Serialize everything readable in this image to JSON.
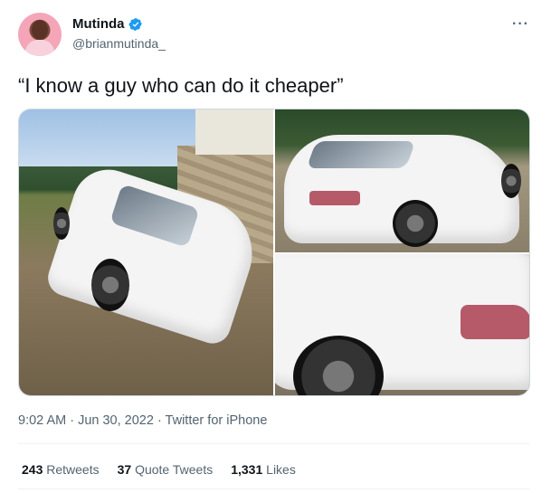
{
  "author": {
    "display_name": "Mutinda",
    "handle": "@brianmutinda_",
    "verified": true
  },
  "tweet": {
    "text": "“I know a guy who can do it cheaper”",
    "more_label": "···"
  },
  "media": {
    "count": 3
  },
  "meta": {
    "timestamp": "9:02 AM · Jun 30, 2022 · Twitter for iPhone"
  },
  "stats": {
    "retweets_count": "243",
    "retweets_label": "Retweets",
    "quotes_count": "37",
    "quotes_label": "Quote Tweets",
    "likes_count": "1,331",
    "likes_label": "Likes"
  },
  "colors": {
    "verified": "#1d9bf0",
    "muted_text": "#536471",
    "text": "#0f1419"
  }
}
